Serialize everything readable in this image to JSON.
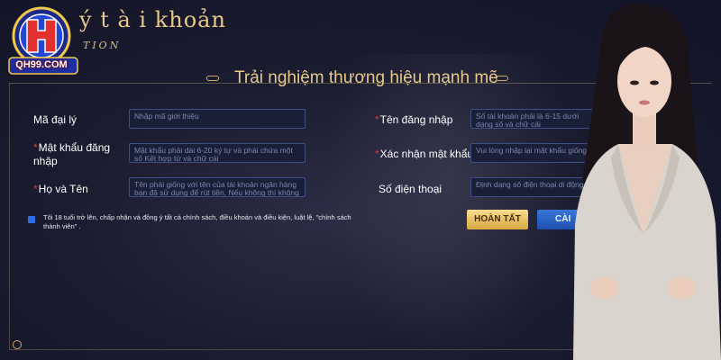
{
  "header": {
    "title": "ý t à i khoản",
    "subtitle": "TION",
    "logo_text": "QH99.COM"
  },
  "form": {
    "title": "Trải nghiệm thương hiệu mạnh mẽ",
    "fields": {
      "agent_code": {
        "label": "Mã đại lý",
        "placeholder": "Nhập mã giới thiệu"
      },
      "username": {
        "label": "Tên đăng nhập",
        "placeholder": "Số tài khoản phải là 6-15 dưới dạng số và chữ cái"
      },
      "password": {
        "label": "Mật khẩu đăng nhập",
        "placeholder": "Mật khẩu phải dài 6-20 ký tự và phải chứa một số Kết hợp từ và chữ cái"
      },
      "confirm_password": {
        "label": "Xác nhận mật khẩu",
        "placeholder": "Vui lòng nhập lại mật khẩu giống"
      },
      "full_name": {
        "label": "Họ và Tên",
        "placeholder": "Tên phải giống với tên của tài khoản ngân hàng bạn đã sử dụng để rút tiền, Nếu không thì không thể rút"
      },
      "phone": {
        "label": "Số điện thoại",
        "placeholder": "Định dạng số điện thoại di động"
      }
    },
    "required_mark": "*",
    "terms": "Tôi 18 tuổi trở lên, chấp nhận và đồng ý tất cả chính sách, điều khoản và điều kiện, luật lệ, \"chính sách thành viên\" .",
    "finish_button": "HOÀN TẤT",
    "cancel_button": "CÀI"
  },
  "colors": {
    "accent_gold": "#e6c98a",
    "field_border": "#3f4f86",
    "cancel_blue": "#2f6ee8"
  }
}
